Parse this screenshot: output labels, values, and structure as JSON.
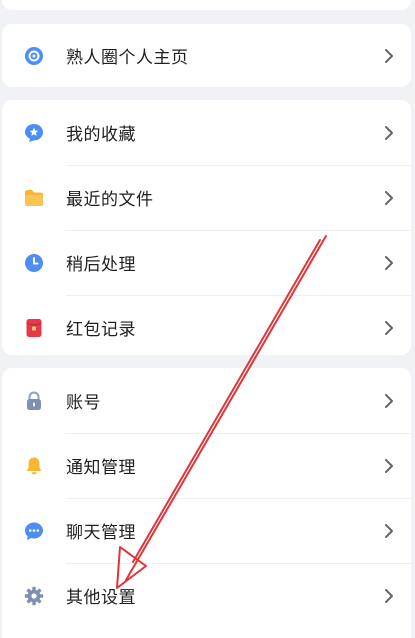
{
  "menu": {
    "group1": [
      {
        "label": "熟人圈个人主页",
        "icon": "moments-icon"
      }
    ],
    "group2": [
      {
        "label": "我的收藏",
        "icon": "star-icon"
      },
      {
        "label": "最近的文件",
        "icon": "folder-icon"
      },
      {
        "label": "稍后处理",
        "icon": "clock-icon"
      },
      {
        "label": "红包记录",
        "icon": "red-envelope-icon"
      }
    ],
    "group3": [
      {
        "label": "账号",
        "icon": "lock-icon"
      },
      {
        "label": "通知管理",
        "icon": "bell-icon"
      },
      {
        "label": "聊天管理",
        "icon": "chat-bubble-icon"
      },
      {
        "label": "其他设置",
        "icon": "gear-icon"
      }
    ]
  },
  "colors": {
    "blue": "#4d8ef6",
    "orange": "#f7b733",
    "red": "#e8394a",
    "gray": "#7f8fb0",
    "annotation": "#e0353a"
  }
}
